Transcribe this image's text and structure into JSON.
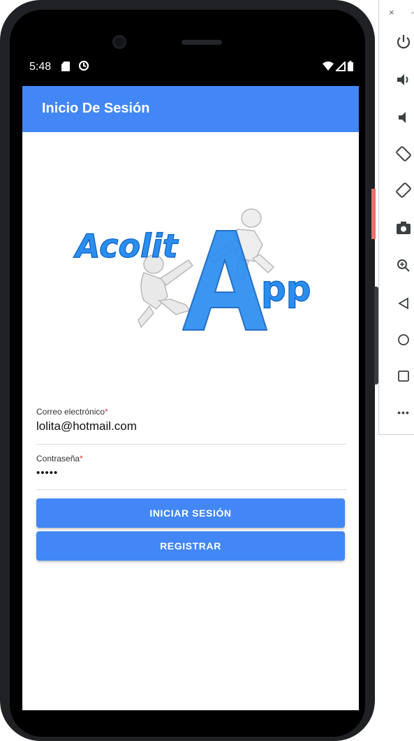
{
  "status_bar": {
    "time": "5:48"
  },
  "app_bar": {
    "title": "Inicio De Sesión"
  },
  "logo": {
    "text_main": "Acolit",
    "text_a": "A",
    "text_pp": "pp"
  },
  "form": {
    "email": {
      "label": "Correo electrónico",
      "required_mark": "*",
      "value": "lolita@hotmail.com"
    },
    "password": {
      "label": "Contraseña",
      "required_mark": "*",
      "value": "•••••"
    },
    "login_button": "INICIAR SESIÓN",
    "register_button": "REGISTRAR"
  },
  "emulator_toolbar": {
    "close": "×",
    "minimize": "–",
    "more": "•••",
    "icons": [
      "power-icon",
      "volume-up-icon",
      "volume-down-icon",
      "rotate-left-icon",
      "rotate-right-icon",
      "camera-icon",
      "zoom-icon",
      "back-icon",
      "home-icon",
      "overview-icon",
      "more-icon"
    ]
  },
  "colors": {
    "primary": "#4287f5",
    "logo_blue": "#2a8ef0",
    "required": "#e53935",
    "toolbar_icon": "#3c4043"
  }
}
